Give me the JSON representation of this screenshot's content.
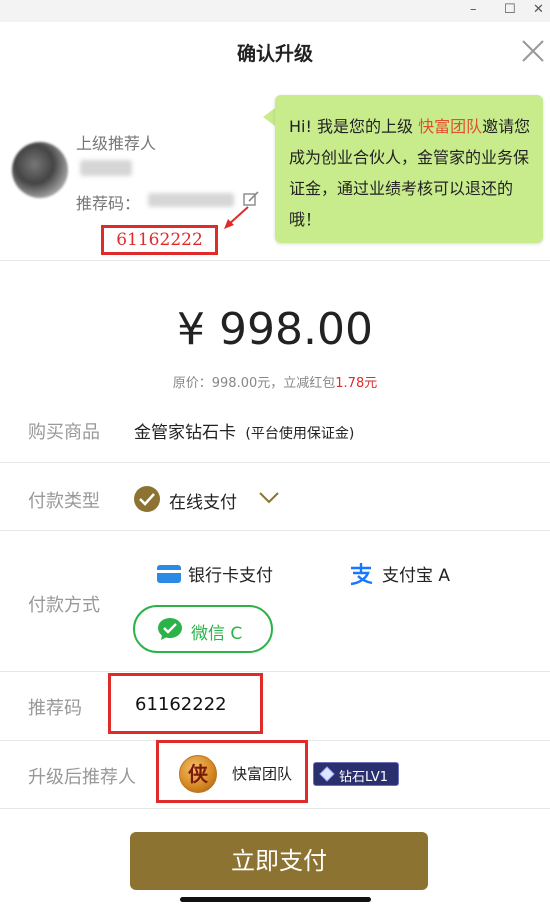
{
  "header": {
    "title": "确认升级"
  },
  "referrer": {
    "label": "上级推荐人",
    "code_label": "推荐码：",
    "code": "61162222"
  },
  "bubble": {
    "before": "Hi! 我是您的上级 ",
    "team": "快富团队",
    "after": "邀请您成为创业合伙人，金管家的业务保证金，通过业绩考核可以退还的哦！"
  },
  "price": {
    "amount": "¥ 998.00",
    "original_text": "原价：998.00元，立减红包",
    "discount": "1.78元"
  },
  "product": {
    "label": "购买商品",
    "name": "金管家钻石卡",
    "note": "(平台使用保证金)"
  },
  "payment_type": {
    "label": "付款类型",
    "value": "在线支付"
  },
  "payment_method": {
    "label": "付款方式",
    "options": [
      {
        "label": "银行卡支付"
      },
      {
        "label": "支付宝 A"
      },
      {
        "label": "微信 C"
      }
    ]
  },
  "referral_code": {
    "label": "推荐码",
    "value": "61162222"
  },
  "upgraded_referrer": {
    "label": "升级后推荐人",
    "name": "快富团队",
    "avatar_char": "侠",
    "badge": "钻石LV1"
  },
  "pay_button": {
    "label": "立即支付"
  },
  "colors": {
    "accent": "#8c7332",
    "highlight_red": "#e02b2b",
    "bubble_green": "#c8ec8c",
    "wechat_green": "#2bb34a",
    "alipay_blue": "#1677ff"
  }
}
